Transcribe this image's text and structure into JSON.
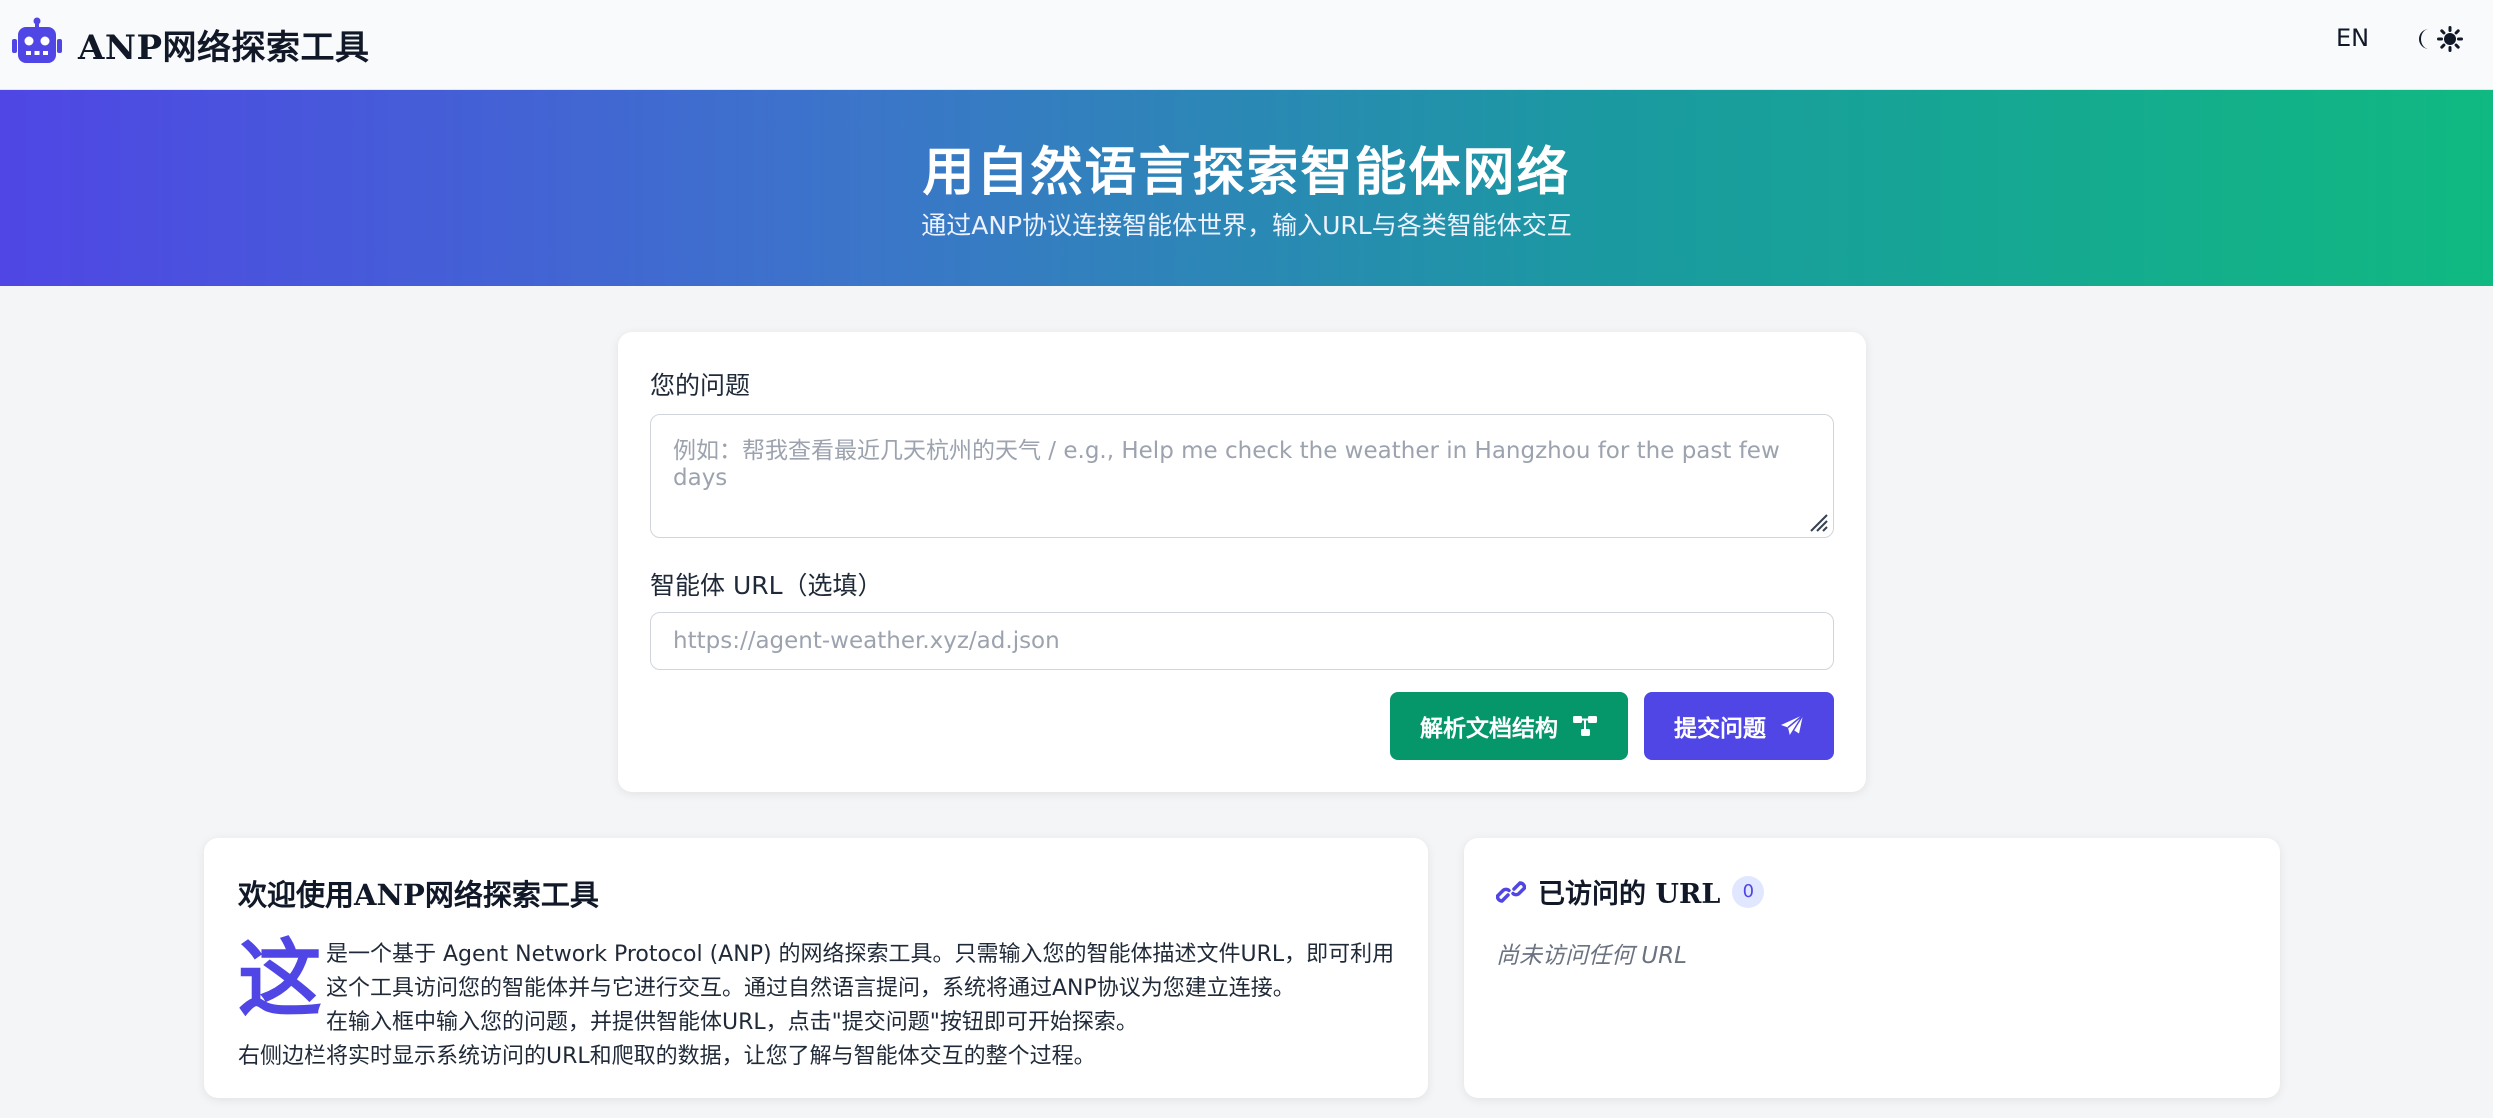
{
  "app": {
    "title": "ANP网络探索工具",
    "lang_toggle": "EN"
  },
  "hero": {
    "title": "用自然语言探索智能体网络",
    "subtitle": "通过ANP协议连接智能体世界，输入URL与各类智能体交互"
  },
  "form": {
    "question_label": "您的问题",
    "question_placeholder": "例如：帮我查看最近几天杭州的天气 / e.g., Help me check the weather in Hangzhou for the past few days",
    "url_label": "智能体 URL（选填）",
    "url_placeholder": "https://agent-weather.xyz/ad.json",
    "parse_button": "解析文档结构",
    "submit_button": "提交问题"
  },
  "welcome": {
    "title": "欢迎使用ANP网络探索工具",
    "dropcap": "这",
    "line1": "是一个基于 Agent Network Protocol (ANP) 的网络探索工具。只需输入您的智能体描述文件URL，即可利用",
    "line2": "这个工具访问您的智能体并与它进行交互。通过自然语言提问，系统将通过ANP协议为您建立连接。",
    "line3": "在输入框中输入您的问题，并提供智能体URL，点击\"提交问题\"按钮即可开始探索。",
    "line4": "右侧边栏将实时显示系统访问的URL和爬取的数据，让您了解与智能体交互的整个过程。"
  },
  "visited": {
    "title": "已访问的 URL",
    "count": "0",
    "empty_text": "尚未访问任何 URL"
  },
  "colors": {
    "primary": "#4f46e5",
    "success": "#059669",
    "gradient_start": "#4f46e5",
    "gradient_end": "#10b981"
  },
  "icons": {
    "logo": "robot-icon",
    "theme": "moon-sun-icon",
    "parse": "sitemap-icon",
    "submit": "paper-plane-icon",
    "visited": "link-icon"
  }
}
